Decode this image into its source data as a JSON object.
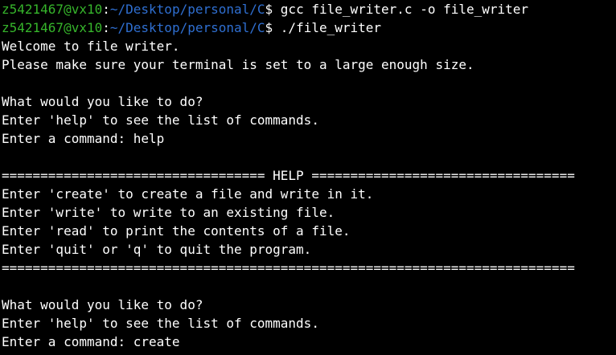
{
  "colors": {
    "background": "#000000",
    "text": "#ffffff",
    "prompt_user": "#36b52b",
    "prompt_path": "#2f6fd1"
  },
  "prompts": [
    {
      "user": "z5421467@vx10",
      "sep": ":",
      "path": "~/Desktop/personal/C",
      "symbol": "$ ",
      "command": "gcc file_writer.c -o file_writer"
    },
    {
      "user": "z5421467@vx10",
      "sep": ":",
      "path": "~/Desktop/personal/C",
      "symbol": "$ ",
      "command": "./file_writer"
    }
  ],
  "output": [
    "Welcome to file writer.",
    "Please make sure your terminal is set to a large enough size.",
    "",
    "What would you like to do?",
    "Enter 'help' to see the list of commands.",
    "Enter a command: help",
    "",
    "================================== HELP ==================================",
    "Enter 'create' to create a file and write in it.",
    "Enter 'write' to write to an existing file.",
    "Enter 'read' to print the contents of a file.",
    "Enter 'quit' or 'q' to quit the program.",
    "==========================================================================",
    "",
    "What would you like to do?",
    "Enter 'help' to see the list of commands.",
    "Enter a command: create"
  ]
}
